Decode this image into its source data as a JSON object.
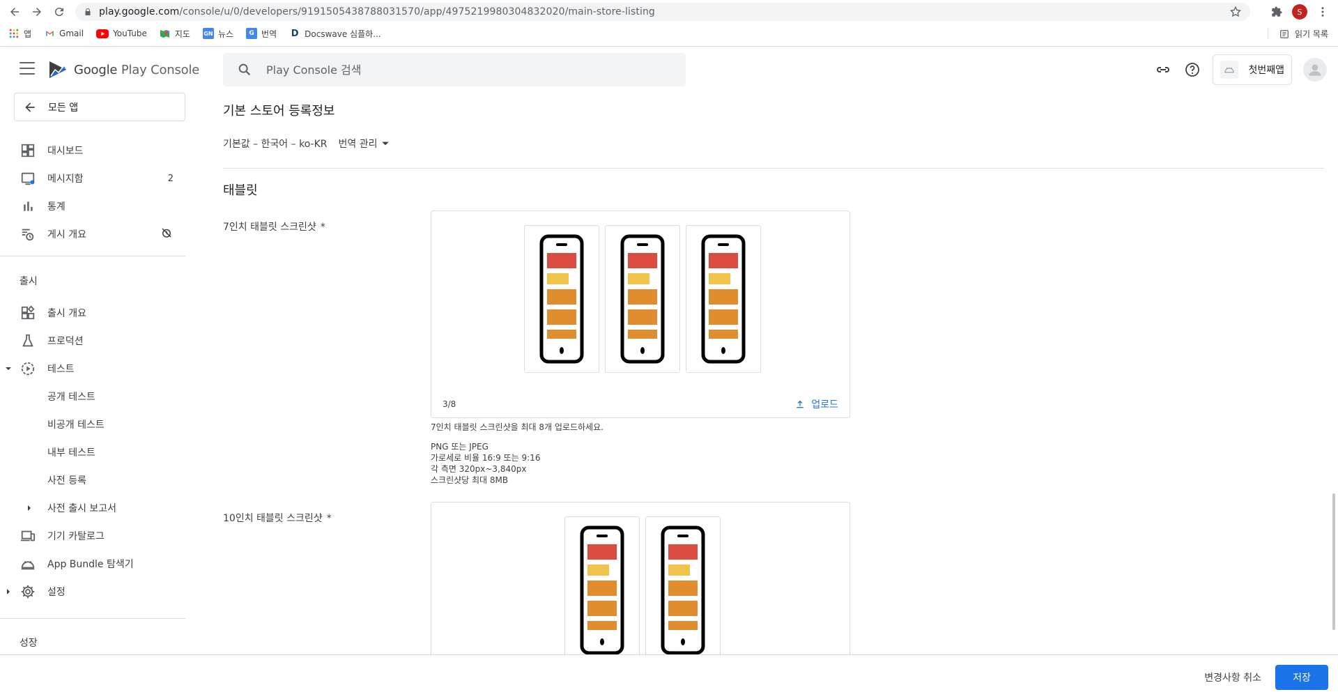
{
  "browser": {
    "url_host": "play.google.com",
    "url_path": "/console/u/0/developers/9191505438788031570/app/4975219980304832020/main-store-listing",
    "profile_initial": "S",
    "bookmarks": [
      {
        "label": "앱",
        "icon": "apps-grid-icon"
      },
      {
        "label": "Gmail",
        "icon": "gmail-icon"
      },
      {
        "label": "YouTube",
        "icon": "youtube-icon"
      },
      {
        "label": "지도",
        "icon": "maps-icon"
      },
      {
        "label": "뉴스",
        "icon": "news-icon"
      },
      {
        "label": "번역",
        "icon": "translate-icon"
      },
      {
        "label": "Docswave 심플하...",
        "icon": "docswave-icon"
      }
    ],
    "reading_list": "읽기 목록"
  },
  "header": {
    "logo_text_1": "Google",
    "logo_text_2": "Play Console",
    "search_placeholder": "Play Console 검색",
    "app_name": "첫번째앱"
  },
  "sidebar": {
    "all_apps": "모든 앱",
    "items": [
      {
        "label": "대시보드",
        "icon": "dashboard-icon"
      },
      {
        "label": "메시지함",
        "icon": "inbox-icon",
        "badge": "2"
      },
      {
        "label": "통계",
        "icon": "bar-chart-icon"
      },
      {
        "label": "게시 개요",
        "icon": "publishing-overview-icon"
      }
    ],
    "section_release": "출시",
    "release_items": [
      {
        "label": "출시 개요",
        "icon": "release-overview-icon"
      },
      {
        "label": "프로덕션",
        "icon": "production-icon"
      },
      {
        "label": "테스트",
        "icon": "testing-icon"
      },
      {
        "label": "공개 테스트"
      },
      {
        "label": "비공개 테스트"
      },
      {
        "label": "내부 테스트"
      },
      {
        "label": "사전 등록"
      },
      {
        "label": "사전 출시 보고서"
      },
      {
        "label": "기기 카탈로그",
        "icon": "device-catalog-icon"
      },
      {
        "label": "App Bundle 탐색기",
        "icon": "app-bundle-icon"
      },
      {
        "label": "설정",
        "icon": "settings-icon"
      }
    ],
    "section_growth": "성장"
  },
  "main": {
    "page_title": "기본 스토어 등록정보",
    "default_lang": "기본값 – 한국어 – ko-KR",
    "translate_label": "번역 관리",
    "section_title": "태블릿",
    "tablet7": {
      "label": "7인치 태블릿 스크린샷",
      "required": "*",
      "count": "3/8",
      "upload": "업로드",
      "hint_main": "7인치 태블릿 스크린샷을 최대 8개 업로드하세요.",
      "hint_format": "PNG 또는 JPEG",
      "hint_ratio": "가로세로 비율 16:9 또는 9:16",
      "hint_size": "각 측면 320px~3,840px",
      "hint_max": "스크린샷당 최대 8MB"
    },
    "tablet10": {
      "label": "10인치 태블릿 스크린샷",
      "required": "*"
    }
  },
  "footer": {
    "discard": "변경사항 취소",
    "save": "저장"
  },
  "colors": {
    "accent": "#1a73e8",
    "thumb_red": "#db4b3f",
    "thumb_yellow": "#f0c34c",
    "thumb_orange": "#e08d30"
  }
}
